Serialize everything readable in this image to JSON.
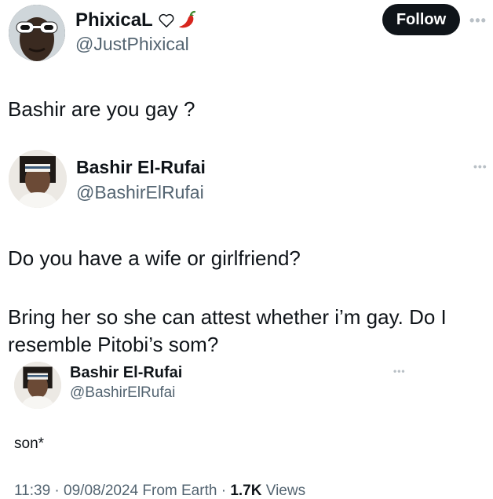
{
  "post1": {
    "display_name": "PhixicaL",
    "handle": "@JustPhixical",
    "follow_label": "Follow",
    "more_label": "•••",
    "text": "Bashir are you gay ?",
    "name_icons": [
      "heart-outline-icon",
      "chili-pepper-icon"
    ]
  },
  "post2": {
    "display_name": "Bashir El-Rufai",
    "handle": "@BashirElRufai",
    "more_label": "•••",
    "text_line1": "Do you have a wife or girlfriend?",
    "text_para2": "Bring her so she can attest whether i’m gay. Do I resemble Pitobi’s som?"
  },
  "post3": {
    "display_name": "Bashir El-Rufai",
    "handle": "@BashirElRufai",
    "more_label": "•••",
    "text": "son*"
  },
  "meta": {
    "time": "11:39",
    "sep1": " · ",
    "date": "09/08/2024",
    "source": " From Earth",
    "sep2": " · ",
    "views_count": "1.7K",
    "views_label": " Views"
  },
  "colors": {
    "text": "#0f1419",
    "secondary": "#536471",
    "follow_bg": "#0f1419",
    "chili": "#d7261e"
  }
}
